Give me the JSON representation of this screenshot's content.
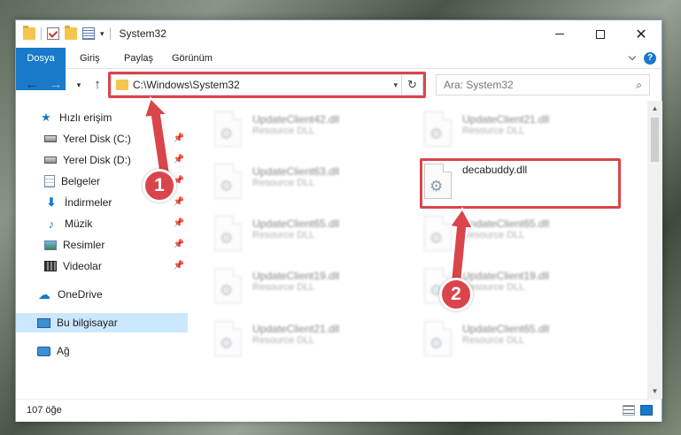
{
  "titlebar": {
    "title": "System32",
    "minimize_icon": "minimize-icon",
    "maximize_icon": "maximize-icon",
    "close_glyph": "✕"
  },
  "ribbon": {
    "tabs": [
      {
        "label": "Dosya"
      },
      {
        "label": "Giriş"
      },
      {
        "label": "Paylaş"
      },
      {
        "label": "Görünüm"
      }
    ],
    "help": "?"
  },
  "address": {
    "path": "C:\\Windows\\System32",
    "search_placeholder": "Ara: System32"
  },
  "nav": {
    "quick_access": "Hızlı erişim",
    "items": [
      {
        "label": "Yerel Disk (C:)",
        "icon": "disk-icon"
      },
      {
        "label": "Yerel Disk (D:)",
        "icon": "disk-icon"
      },
      {
        "label": "Belgeler",
        "icon": "document-icon"
      },
      {
        "label": "İndirmeler",
        "icon": "download-icon"
      },
      {
        "label": "Müzik",
        "icon": "music-icon"
      },
      {
        "label": "Resimler",
        "icon": "pictures-icon"
      },
      {
        "label": "Videolar",
        "icon": "videos-icon"
      }
    ],
    "onedrive": "OneDrive",
    "this_pc": "Bu bilgisayar",
    "network": "Ağ"
  },
  "files": {
    "left": [
      {
        "name": "UpdateClient42.dll",
        "type": "Resource DLL"
      },
      {
        "name": "UpdateClient63.dll",
        "type": "Resource DLL"
      },
      {
        "name": "UpdateClient65.dll",
        "type": "Resource DLL"
      },
      {
        "name": "UpdateClient19.dll",
        "type": "Resource DLL"
      },
      {
        "name": "UpdateClient21.dll",
        "type": "Resource DLL"
      }
    ],
    "right": [
      {
        "name": "UpdateClient21.dll",
        "type": "Resource DLL"
      },
      {
        "name": "decabuddy.dll",
        "type": ""
      },
      {
        "name": "UpdateClient65.dll",
        "type": "Resource DLL"
      },
      {
        "name": "UpdateClient19.dll",
        "type": "Resource DLL"
      },
      {
        "name": "UpdateClient65.dll",
        "type": "Resource DLL"
      }
    ]
  },
  "status": {
    "count": "107 öğe"
  },
  "annotations": {
    "badge1": "1",
    "badge2": "2",
    "color": "#d9454b"
  }
}
